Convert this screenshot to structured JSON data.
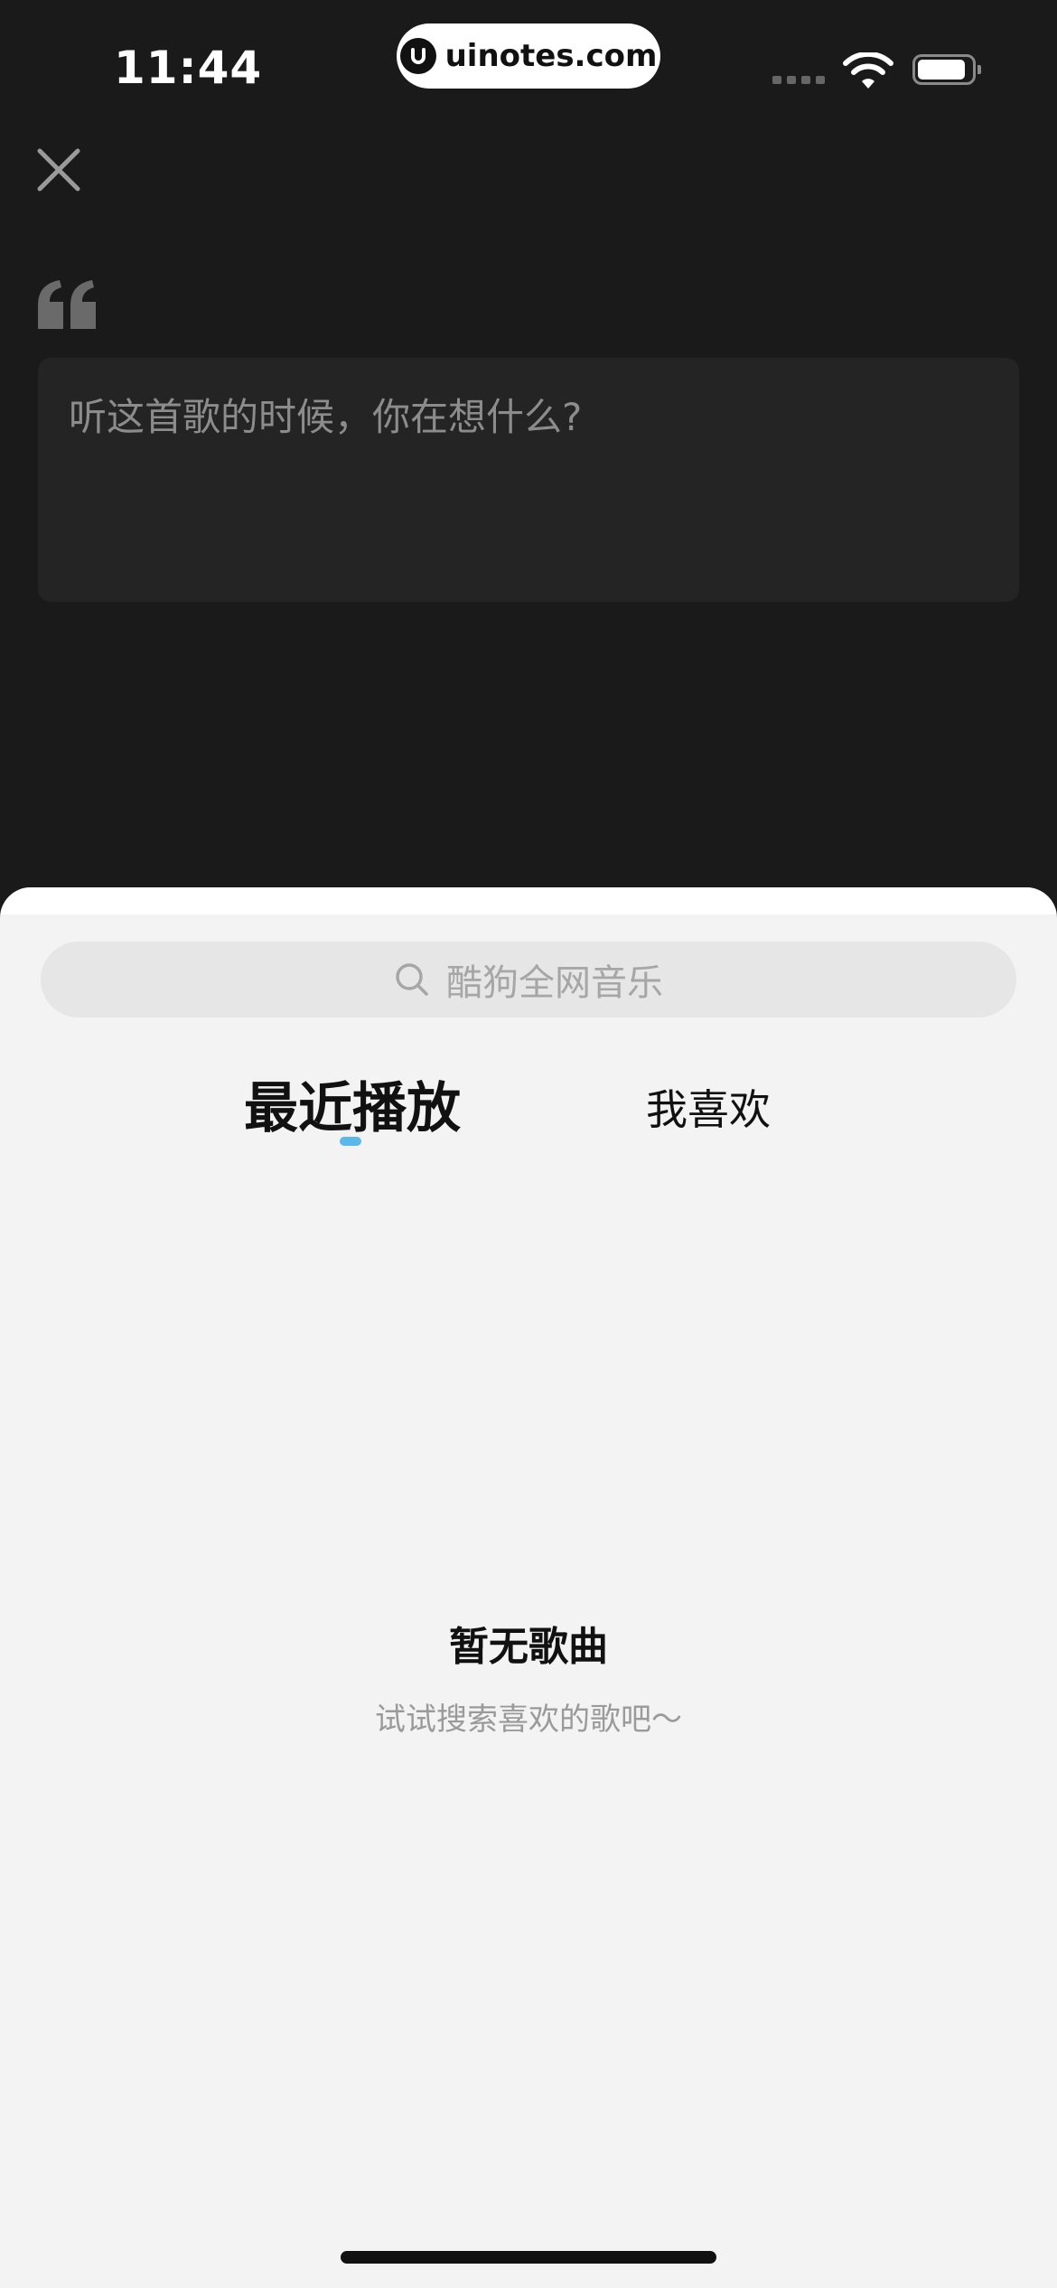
{
  "status_bar": {
    "time": "11:44",
    "url": "uinotes.com"
  },
  "editor": {
    "placeholder": "听这首歌的时候，你在想什么?"
  },
  "search": {
    "placeholder": "酷狗全网音乐"
  },
  "tabs": [
    {
      "label": "最近播放",
      "active": true
    },
    {
      "label": "我喜欢",
      "active": false
    }
  ],
  "empty_state": {
    "title": "暂无歌曲",
    "hint": "试试搜索喜欢的歌吧～"
  },
  "colors": {
    "background": "#1a1a1a",
    "sheet": "#f3f3f3",
    "accent": "#5bb8e8"
  }
}
